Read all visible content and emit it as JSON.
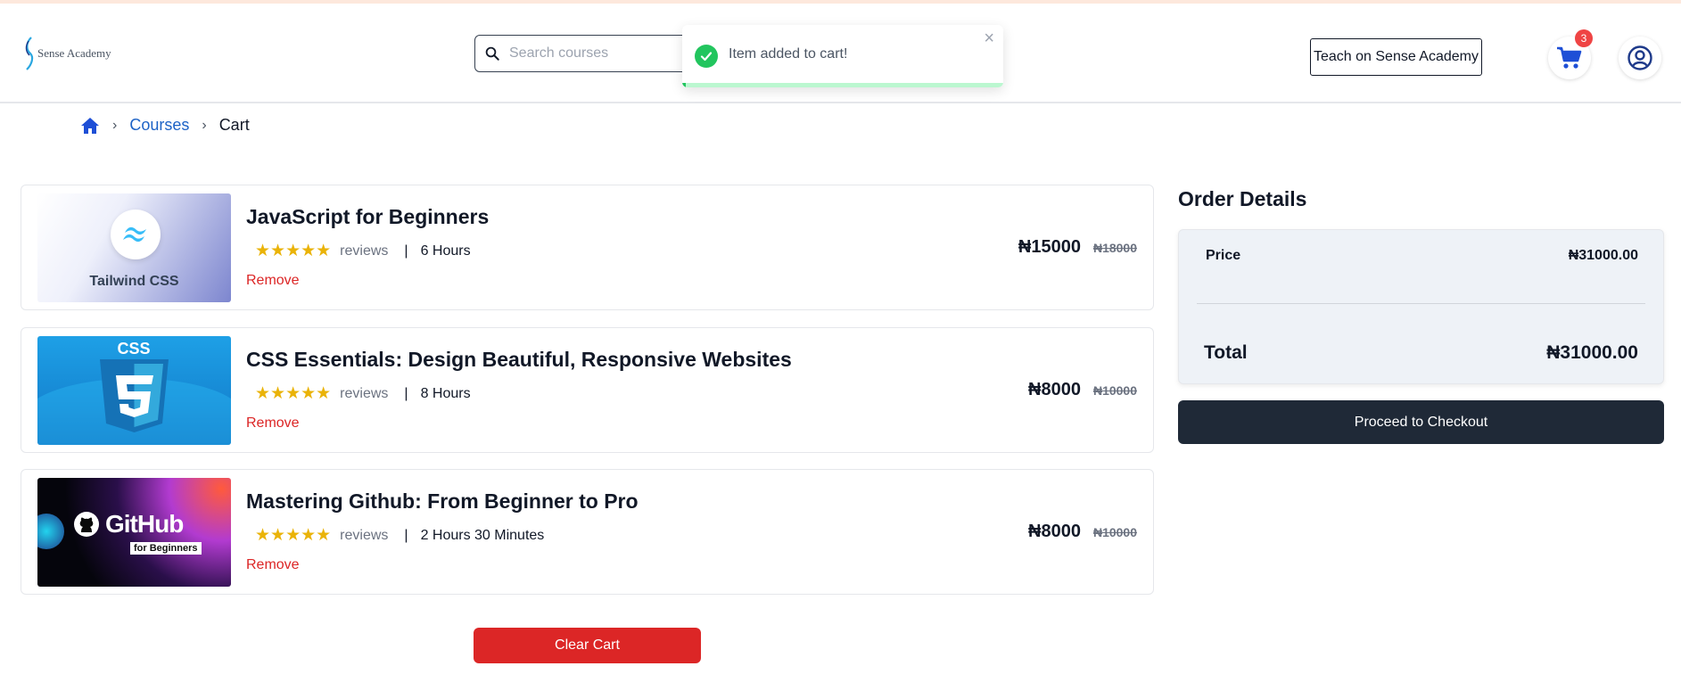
{
  "brand": {
    "name": "Sense Academy"
  },
  "search": {
    "placeholder": "Search courses"
  },
  "toast": {
    "message": "Item added to cart!",
    "close_glyph": "×",
    "progress": 0.01
  },
  "header": {
    "teach_label": "Teach on Sense Academy",
    "cart_count": "3"
  },
  "breadcrumb": {
    "items": [
      "Courses",
      "Cart"
    ],
    "separator": "›"
  },
  "cart": {
    "items": [
      {
        "title": "JavaScript for Beginners",
        "stars": "★★★★★",
        "reviews": "reviews",
        "duration": "6 Hours",
        "remove": "Remove",
        "price": "₦15000",
        "old_price": "₦18000",
        "thumb_text": "Tailwind CSS"
      },
      {
        "title": "CSS Essentials: Design Beautiful, Responsive Websites",
        "stars": "★★★★★",
        "reviews": "reviews",
        "duration": "8 Hours",
        "remove": "Remove",
        "price": "₦8000",
        "old_price": "₦10000",
        "thumb_text": "CSS"
      },
      {
        "title": "Mastering Github: From Beginner to Pro",
        "stars": "★★★★★",
        "reviews": "reviews",
        "duration": "2 Hours 30 Minutes",
        "remove": "Remove",
        "price": "₦8000",
        "old_price": "₦10000",
        "thumb_text": "GitHub",
        "thumb_subtext": "for Beginners"
      }
    ],
    "pipe": "|",
    "clear_label": "Clear Cart"
  },
  "order": {
    "title": "Order Details",
    "price_label": "Price",
    "price_value": "₦31000.00",
    "total_label": "Total",
    "total_value": "₦31000.00",
    "checkout_label": "Proceed to Checkout"
  },
  "colors": {
    "accent": "#1e63c6",
    "danger": "#dc2626",
    "dark": "#1f2937",
    "star": "#eab308",
    "success": "#22c55e"
  }
}
